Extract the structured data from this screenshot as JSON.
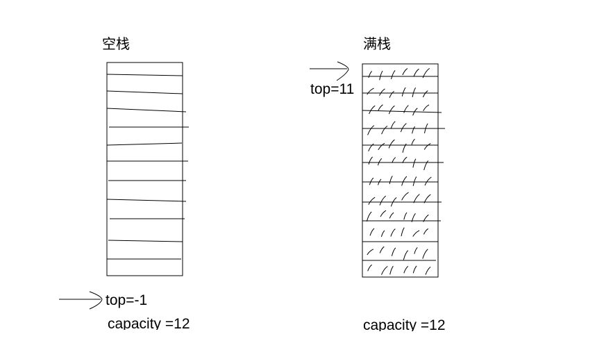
{
  "empty_stack": {
    "title": "空栈",
    "pointer_label": "top=-1",
    "capacity_label": "capacity =12"
  },
  "full_stack": {
    "title": "满栈",
    "pointer_label": "top=11",
    "capacity_label": "capacity =12"
  },
  "colors": {
    "stroke": "#000000",
    "background": "#ffffff"
  }
}
